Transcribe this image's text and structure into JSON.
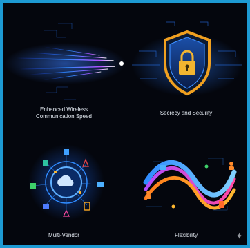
{
  "panels": [
    {
      "caption_lines": [
        "Enhanced Wireless",
        "Communication Speed"
      ],
      "icon": "speed-streaks-icon"
    },
    {
      "caption_lines": [
        "Secrecy and Security"
      ],
      "icon": "shield-lock-icon"
    },
    {
      "caption_lines": [
        "Multi-Vendor"
      ],
      "icon": "cloud-hub-icon"
    },
    {
      "caption_lines": [
        "Flexibility"
      ],
      "icon": "flexible-network-icon"
    }
  ],
  "colors": {
    "border": "#1d9ad3",
    "background": "#04060d",
    "accent_blue": "#2f8bff",
    "accent_purple": "#b24cff",
    "accent_orange": "#f0a020",
    "text": "#e6ecf4"
  },
  "watermark_icon": "sparkle-icon"
}
